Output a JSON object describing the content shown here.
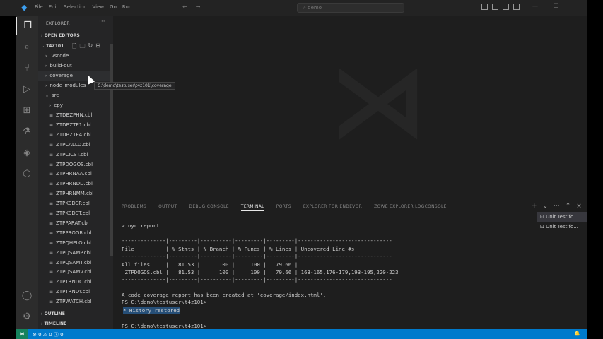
{
  "menu": [
    "File",
    "Edit",
    "Selection",
    "View",
    "Go",
    "Run",
    "..."
  ],
  "search_placeholder": "demo",
  "explorer": {
    "title": "EXPLORER",
    "open_editors": "OPEN EDITORS",
    "root": "T4Z101",
    "folders": [
      ".vscode",
      "build-out",
      "coverage",
      "node_modules"
    ],
    "src": "src",
    "cpy": "cpy",
    "files": [
      "ZTDBZPHN.cbl",
      "ZTDBZTE1.cbl",
      "ZTDBZTE4.cbl",
      "ZTPCALLD.cbl",
      "ZTPCICST.cbl",
      "ZTPDOGOS.cbl",
      "ZTPHRNAA.cbl",
      "ZTPHRNDD.cbl",
      "ZTPHRNMM.cbl",
      "ZTPKSDSP.cbl",
      "ZTPKSDST.cbl",
      "ZTPPARAT.cbl",
      "ZTPPROGR.cbl",
      "ZTPQHELO.cbl",
      "ZTPQSAMP.cbl",
      "ZTPQSAMT.cbl",
      "ZTPQSAMV.cbl",
      "ZTPTRNDC.cbl",
      "ZTPTRNDY.cbl",
      "ZTPWATCH.cbl"
    ],
    "outline": "OUTLINE",
    "timeline": "TIMELINE"
  },
  "tooltip": "C:\\demo\\testuser\\t4z101\\coverage",
  "panel": {
    "tabs": [
      "PROBLEMS",
      "OUTPUT",
      "DEBUG CONSOLE",
      "TERMINAL",
      "PORTS",
      "EXPLORER FOR ENDEVOR",
      "ZOWE EXPLORER LOGCONSOLE"
    ],
    "active_tab": "TERMINAL"
  },
  "terminal": {
    "lines": [
      "> nyc report",
      "",
      "--------------|---------|----------|---------|---------|------------------------------",
      "File          | % Stmts | % Branch | % Funcs | % Lines | Uncovered Line #s",
      "--------------|---------|----------|---------|---------|------------------------------",
      "All files     |   81.53 |      100 |     100 |   79.66 |",
      " ZTPDOGOS.cbl |   81.53 |      100 |     100 |   79.66 | 163-165,176-179,193-195,220-223",
      "--------------|---------|----------|---------|---------|------------------------------",
      "",
      "A code coverage report has been created at 'coverage/index.html'.",
      "PS C:\\demo\\testuser\\t4z101>",
      "",
      "",
      "PS C:\\demo\\testuser\\t4z101>"
    ],
    "selection_text": "* History restored"
  },
  "terminal_list": [
    "Unit Test fo...",
    "Unit Test fo..."
  ],
  "status": {
    "problems": "⊗ 0 ⚠ 0   ⓘ 0"
  }
}
